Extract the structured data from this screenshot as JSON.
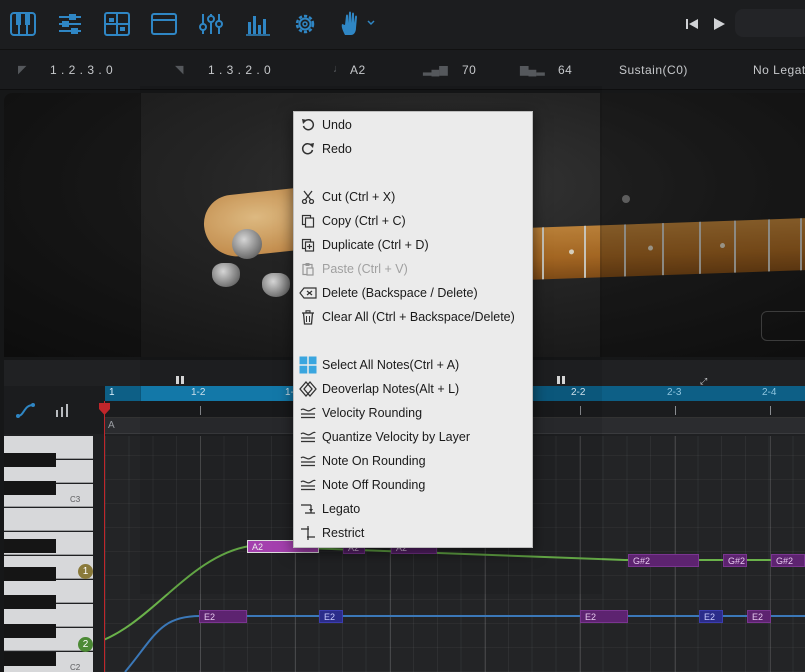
{
  "info_bar": {
    "start_position": "1 . 2 . 3 . 0",
    "end_position": "1 . 3 . 2 . 0",
    "note_name": "A2",
    "velocity": "70",
    "velocity_2": "64",
    "articulation": "Sustain(C0)",
    "legato_state": "No Legato"
  },
  "ruler": {
    "labels": [
      "1",
      "1-2",
      "1-",
      "2-2",
      "2-3",
      "2-4"
    ]
  },
  "chord_row": {
    "label": "A"
  },
  "piano_keys": {
    "c3_label": "C3",
    "c2_label": "C2"
  },
  "velocity_layers": {
    "layer1": "1",
    "layer2": "2"
  },
  "notes": [
    {
      "label": "A2",
      "style": "sel"
    },
    {
      "label": "A2",
      "style": "purple"
    },
    {
      "label": "A2",
      "style": "purple"
    },
    {
      "label": "G#2",
      "style": "purple"
    },
    {
      "label": "G#2",
      "style": "purple"
    },
    {
      "label": "G#2",
      "style": "purple"
    },
    {
      "label": "E2",
      "style": "purple"
    },
    {
      "label": "E2",
      "style": "blue"
    },
    {
      "label": "E2",
      "style": "purple"
    },
    {
      "label": "E2",
      "style": "blue"
    },
    {
      "label": "E2",
      "style": "purple"
    }
  ],
  "context_menu": {
    "items": [
      {
        "label": "Undo",
        "icon": "undo-icon",
        "enabled": true
      },
      {
        "label": "Redo",
        "icon": "redo-icon",
        "enabled": true
      },
      {
        "label": "Cut (Ctrl + X)",
        "icon": "scissors-icon",
        "enabled": true
      },
      {
        "label": "Copy (Ctrl + C)",
        "icon": "copy-icon",
        "enabled": true
      },
      {
        "label": "Duplicate (Ctrl + D)",
        "icon": "duplicate-icon",
        "enabled": true
      },
      {
        "label": "Paste (Ctrl + V)",
        "icon": "paste-icon",
        "enabled": false
      },
      {
        "label": "Delete (Backspace / Delete)",
        "icon": "delete-key-icon",
        "enabled": true
      },
      {
        "label": "Clear All (Ctrl + Backspace/Delete)",
        "icon": "trash-icon",
        "enabled": true
      },
      {
        "label": "Select All Notes(Ctrl + A)",
        "icon": "select-all-icon",
        "enabled": true
      },
      {
        "label": "Deoverlap Notes(Alt + L)",
        "icon": "deoverlap-icon",
        "enabled": true
      },
      {
        "label": "Velocity Rounding",
        "icon": "approx-icon",
        "enabled": true
      },
      {
        "label": "Quantize Velocity by Layer",
        "icon": "approx-icon",
        "enabled": true
      },
      {
        "label": "Note On Rounding",
        "icon": "approx-icon",
        "enabled": true
      },
      {
        "label": "Note Off Rounding",
        "icon": "approx-icon",
        "enabled": true
      },
      {
        "label": "Legato",
        "icon": "legato-icon",
        "enabled": true
      },
      {
        "label": "Restrict",
        "icon": "restrict-icon",
        "enabled": true
      }
    ]
  },
  "colors": {
    "accent_blue": "#2f86c4",
    "ruler_blue": "#1583b7",
    "note_purple": "#5d2370",
    "note_selected": "#b246bd",
    "curve_green": "#6ab24a",
    "curve_blue": "#3b78b8",
    "playhead_red": "#c0262b"
  }
}
